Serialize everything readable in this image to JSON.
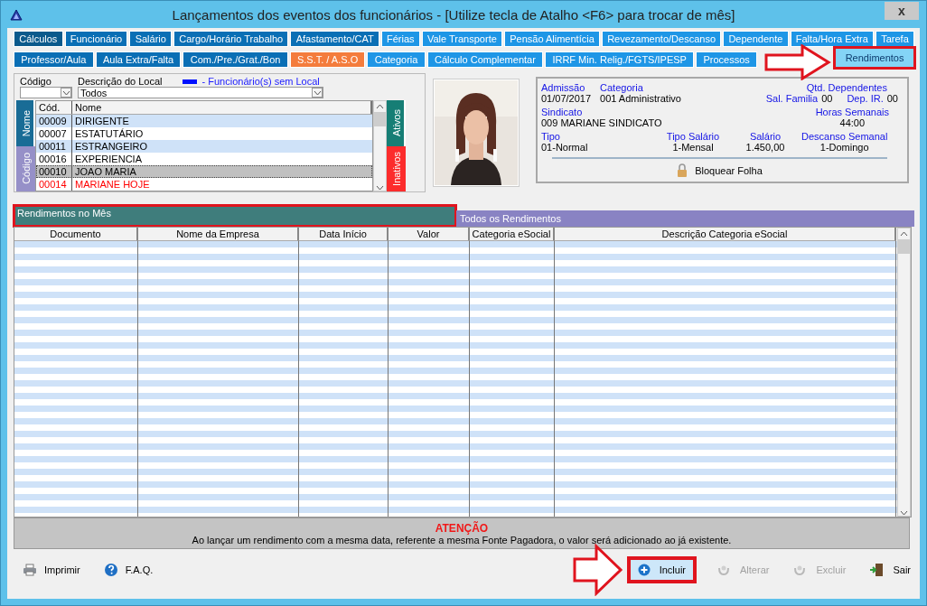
{
  "window": {
    "title": "Lançamentos dos eventos dos funcionários - [Utilize tecla de Atalho <F6> para trocar de mês]",
    "close": "x"
  },
  "tab_rows": [
    [
      {
        "label": "Cálculos",
        "selected": false,
        "color": "#0b5a8c"
      },
      {
        "label": "Funcionário",
        "selected": false,
        "color": "#0a6fb5"
      },
      {
        "label": "Salário",
        "selected": false,
        "color": "#0a6fb5"
      },
      {
        "label": "Cargo/Horário Trabalho",
        "selected": false,
        "color": "#0a6fb5"
      },
      {
        "label": "Afastamento/CAT",
        "selected": false,
        "color": "#0a6fb5"
      },
      {
        "label": "Férias",
        "selected": false,
        "color": "#1e96e6"
      },
      {
        "label": "Vale Transporte",
        "selected": false,
        "color": "#1e96e6"
      },
      {
        "label": "Pensão Alimentícia",
        "selected": false,
        "color": "#1e96e6"
      },
      {
        "label": "Revezamento/Descanso",
        "selected": false,
        "color": "#1e96e6"
      },
      {
        "label": "Dependente",
        "selected": false,
        "color": "#1e96e6"
      },
      {
        "label": "Falta/Hora Extra",
        "selected": false,
        "color": "#1e96e6"
      },
      {
        "label": "Tarefa",
        "selected": false,
        "color": "#1e96e6"
      }
    ],
    [
      {
        "label": "Professor/Aula",
        "selected": false,
        "color": "#0a6fb5"
      },
      {
        "label": "Aula Extra/Falta",
        "selected": false,
        "color": "#0a6fb5"
      },
      {
        "label": "Com./Pre./Grat./Bon",
        "selected": false,
        "color": "#0a6fb5"
      },
      {
        "label": "S.S.T. / A.S.O",
        "selected": false,
        "color": "#f47c3c"
      },
      {
        "label": "Categoria",
        "selected": false,
        "color": "#1e96e6"
      },
      {
        "label": "Cálculo Complementar",
        "selected": false,
        "color": "#1e96e6"
      },
      {
        "label": "IRRF Min. Relig./FGTS/IPESP",
        "selected": false,
        "color": "#1e96e6"
      },
      {
        "label": "Processos",
        "selected": false,
        "color": "#1e96e6"
      },
      {
        "label": "Rendimentos",
        "selected": true,
        "outlined": true,
        "arrow": true
      }
    ]
  ],
  "filter": {
    "code_label": "Código",
    "location_label": "Descrição do Local",
    "location_value": "Todos",
    "legend": "- Funcionário(s) sem Local"
  },
  "employee_list": {
    "sort_tabs": [
      {
        "label": "Nome",
        "selected": true
      },
      {
        "label": "Código",
        "selected": false
      }
    ],
    "status_tabs": [
      {
        "label": "Ativos",
        "selected": true
      },
      {
        "label": "Inativos",
        "selected": false
      }
    ],
    "columns": [
      "Cód.",
      "Nome"
    ],
    "rows": [
      {
        "code": "00009",
        "name": "DIRIGENTE",
        "selected": false,
        "color": "#000000"
      },
      {
        "code": "00007",
        "name": "ESTATUTÁRIO",
        "selected": false,
        "color": "#000000"
      },
      {
        "code": "00011",
        "name": "ESTRANGEIRO",
        "selected": false,
        "color": "#000000"
      },
      {
        "code": "00016",
        "name": "EXPERIENCIA",
        "selected": false,
        "color": "#000000"
      },
      {
        "code": "00010",
        "name": "JOAO MARIA",
        "selected": true,
        "color": "#000000"
      },
      {
        "code": "00014",
        "name": "MARIANE HOJE",
        "selected": false,
        "color": "#ff0000"
      }
    ]
  },
  "info": {
    "admissao_label": "Admissão",
    "admissao": "01/07/2017",
    "categoria_label": "Categoria",
    "categoria": "001  Administrativo",
    "dependentes_label": "Qtd. Dependentes",
    "sal_familia_label": "Sal. Familia",
    "sal_familia": "00",
    "dep_ir_label": "Dep. IR.",
    "dep_ir": "00",
    "sindicato_label": "Sindicato",
    "sindicato": "009  MARIANE SINDICATO",
    "horas_label": "Horas Semanais",
    "horas": "44:00",
    "tipo_label": "Tipo",
    "tipo": "01-Normal",
    "tipo_salario_label": "Tipo Salário",
    "tipo_salario": "1-Mensal",
    "salario_label": "Salário",
    "salario": "1.450,00",
    "descanso_label": "Descanso Semanal",
    "descanso": "1-Domingo",
    "lock": "Bloquear Folha"
  },
  "sub_tabs": [
    {
      "label": "Rendimentos no Mês",
      "selected": true,
      "outlined": true
    },
    {
      "label": "Todos os Rendimentos",
      "selected": false,
      "outlined": false
    }
  ],
  "table": {
    "columns": [
      "Documento",
      "Nome da Empresa",
      "Data Início",
      "Valor",
      "Categoria eSocial",
      "Descrição Categoria eSocial"
    ]
  },
  "notice": {
    "title": "ATENÇÃO",
    "text": "Ao lançar um rendimento com a mesma data, referente a mesma Fonte Pagadora, o valor será adicionado ao já existente."
  },
  "footer_left": [
    {
      "kind": "print",
      "label": "Imprimir"
    },
    {
      "kind": "help",
      "label": "F.A.Q."
    }
  ],
  "footer_right": [
    {
      "kind": "add",
      "label": "Incluir",
      "disabled": false,
      "outlined": true,
      "arrow": true
    },
    {
      "kind": "edit",
      "label": "Alterar",
      "disabled": true,
      "outlined": false,
      "arrow": false
    },
    {
      "kind": "delete",
      "label": "Excluir",
      "disabled": true,
      "outlined": false,
      "arrow": false
    },
    {
      "kind": "exit",
      "label": "Sair",
      "disabled": false,
      "outlined": false,
      "arrow": false
    }
  ]
}
